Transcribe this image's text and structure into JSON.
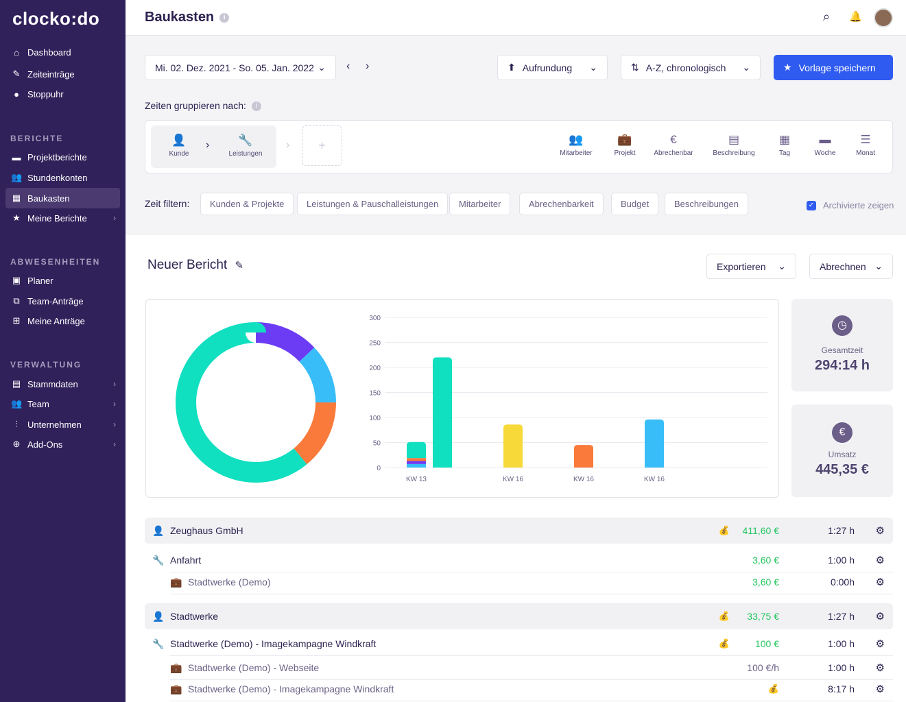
{
  "app": {
    "logo": "clocko:do"
  },
  "sidebar": {
    "main": [
      {
        "label": "Dashboard",
        "icon": "home-icon"
      },
      {
        "label": "Zeiteinträge",
        "icon": "edit-icon"
      },
      {
        "label": "Stoppuhr",
        "icon": "stopwatch-icon"
      }
    ],
    "berichte_title": "BERICHTE",
    "berichte": [
      {
        "label": "Projektberichte"
      },
      {
        "label": "Stundenkonten"
      },
      {
        "label": "Baukasten",
        "active": true
      },
      {
        "label": "Meine Berichte"
      }
    ],
    "abwesenheiten_title": "ABWESENHEITEN",
    "abwesenheiten": [
      {
        "label": "Planer"
      },
      {
        "label": "Team-Anträge"
      },
      {
        "label": "Meine Anträge"
      }
    ],
    "verwaltung_title": "VERWALTUNG",
    "verwaltung": [
      {
        "label": "Stammdaten"
      },
      {
        "label": "Team"
      },
      {
        "label": "Unternehmen"
      },
      {
        "label": "Add-Ons"
      }
    ]
  },
  "header": {
    "title": "Baukasten"
  },
  "toolbar": {
    "date_range": "Mi. 02. Dez. 2021 - So. 05. Jan. 2022",
    "rounding": "Aufrundung",
    "sort": "A-Z, chronologisch",
    "save": "Vorlage speichern"
  },
  "grouping": {
    "label": "Zeiten gruppieren nach:",
    "selected": [
      "Kunde",
      "Leistungen"
    ],
    "add": "+",
    "options": [
      "Mitarbeiter",
      "Projekt",
      "Abrechenbar",
      "Beschreibung",
      "Tag",
      "Woche",
      "Monat"
    ]
  },
  "filter": {
    "label": "Zeit filtern:",
    "pills": [
      "Kunden & Projekte",
      "Leistungen & Pauschalleistungen",
      "Mitarbeiter",
      "Abrechenbarkeit",
      "Budget",
      "Beschreibungen"
    ],
    "archived": "Archivierte zeigen",
    "archived_checked": true
  },
  "report": {
    "title": "Neuer Bericht",
    "export": "Exportieren",
    "bill": "Abrechnen"
  },
  "stats": {
    "total_label": "Gesamtzeit",
    "total": "294:14 h",
    "revenue_label": "Umsatz",
    "revenue": "445,35 €"
  },
  "colors": {
    "teal": "#10dfc0",
    "purple": "#6c3cf5",
    "blue": "#38bdf8",
    "orange": "#f97a3a",
    "yellow": "#f8d93a",
    "accent": "#2f5bf0",
    "green": "#22c55e"
  },
  "chart_data": [
    {
      "type": "pie",
      "donut": true,
      "slices": [
        {
          "color": "#6c3cf5",
          "value": 13
        },
        {
          "color": "#38bdf8",
          "value": 12
        },
        {
          "color": "#f97a3a",
          "value": 14
        },
        {
          "color": "#10dfc0",
          "value": 61
        }
      ]
    },
    {
      "type": "bar",
      "ylim": [
        0,
        300
      ],
      "yticks": [
        0,
        50,
        100,
        150,
        200,
        250,
        300
      ],
      "grid": true,
      "bars": [
        {
          "label": "KW 13",
          "segments": [
            {
              "color": "#38bdf8",
              "value": 7
            },
            {
              "color": "#6c3cf5",
              "value": 6
            },
            {
              "color": "#f97a3a",
              "value": 6
            },
            {
              "color": "#10dfc0",
              "value": 32
            }
          ]
        },
        {
          "label": "",
          "segments": [
            {
              "color": "#10dfc0",
              "value": 220
            }
          ]
        },
        {
          "label": "KW 16",
          "segments": [
            {
              "color": "#f8d93a",
              "value": 86
            }
          ]
        },
        {
          "label": "KW 16",
          "segments": [
            {
              "color": "#f97a3a",
              "value": 45
            }
          ]
        },
        {
          "label": "KW 16",
          "segments": [
            {
              "color": "#38bdf8",
              "value": 96
            }
          ]
        }
      ]
    }
  ],
  "rows": [
    {
      "type": "head",
      "label": "Zeughaus GmbH",
      "money": "411,60 €",
      "time": "1:27 h",
      "bag": true
    },
    {
      "type": "service",
      "label": "Anfahrt",
      "money": "3,60 €",
      "time": "1:00 h"
    },
    {
      "type": "sub",
      "label": "Stadtwerke (Demo)",
      "money": "3,60 €",
      "time": "0:00h"
    },
    {
      "type": "head",
      "label": "Stadtwerke",
      "money": "33,75 €",
      "time": "1:27 h",
      "bag": true
    },
    {
      "type": "service",
      "label": "Stadtwerke (Demo) - Imagekampagne Windkraft",
      "money": "100 €",
      "time": "1:00 h",
      "bag": true
    },
    {
      "type": "sub",
      "label": "Stadtwerke (Demo) - Webseite",
      "money": "100 €/h",
      "time": "1:00 h",
      "gray": true
    },
    {
      "type": "sub",
      "label": "Stadtwerke (Demo) - Imagekampagne Windkraft",
      "money": "",
      "time": "8:17 h",
      "bag": true
    }
  ]
}
